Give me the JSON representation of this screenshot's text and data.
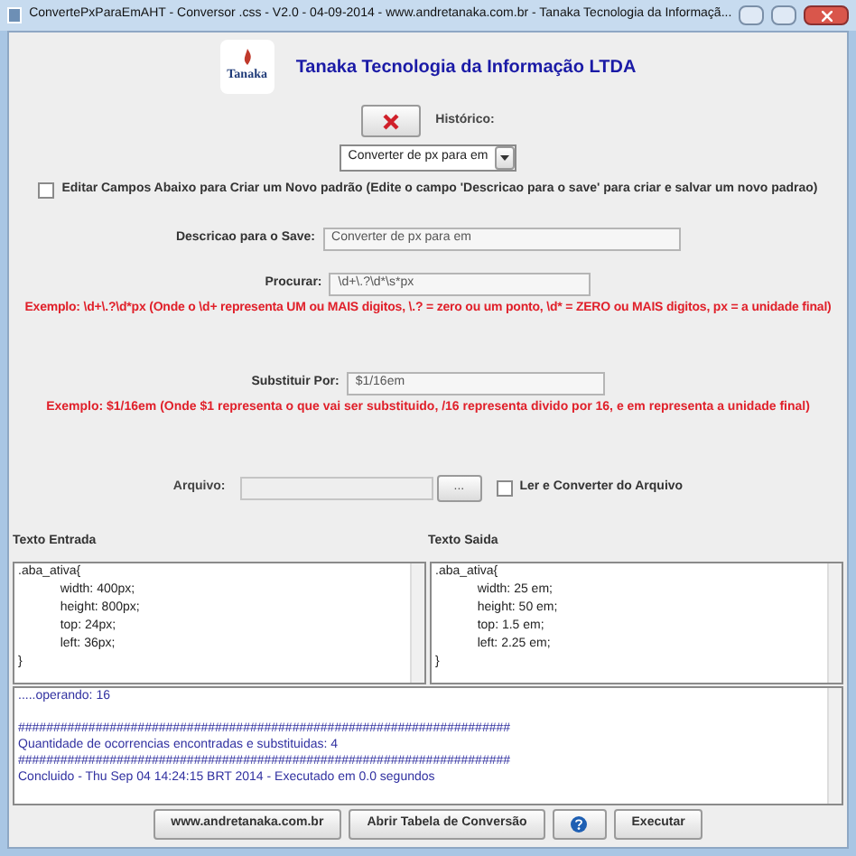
{
  "window": {
    "title": "ConvertePxParaEmAHT - Conversor .css  - V2.0 - 04-09-2014 - www.andretanaka.com.br - Tanaka Tecnologia da Informaçã..."
  },
  "header": {
    "logo_text": "Tanaka",
    "company": "Tanaka Tecnologia da Informação LTDA"
  },
  "historico": {
    "label": "Histórico:",
    "value": "Converter de px para em"
  },
  "edit_checkbox": {
    "label": "Editar Campos Abaixo para Criar um Novo padrão (Edite o campo 'Descricao para o save' para criar e salvar um novo padrao)",
    "checked": false
  },
  "descricao": {
    "label": "Descricao para o Save:",
    "value": "Converter de px para em"
  },
  "procurar": {
    "label": "Procurar:",
    "value": "\\d+\\.?\\d*\\s*px",
    "example": "Exemplo: \\d+\\.?\\d*px (Onde o \\d+ representa UM ou MAIS digitos, \\.? = zero ou um ponto, \\d* = ZERO ou MAIS digitos,  px = a unidade final)"
  },
  "substituir": {
    "label": "Substituir Por:",
    "value": "$1/16em",
    "example": "Exemplo: $1/16em (Onde $1 representa o que vai ser substituido, /16 representa divido por 16, e em representa a unidade final)"
  },
  "arquivo": {
    "label": "Arquivo:",
    "browse": "...",
    "read_checkbox": {
      "label": "Ler e Converter do Arquivo",
      "checked": false
    }
  },
  "texto_entrada": {
    "label": "Texto Entrada",
    "lines": [
      ".aba_ativa{",
      "\t\twidth: 400px;",
      "\t\theight: 800px;",
      "\t\ttop: 24px;",
      "\t\tleft: 36px;",
      "}"
    ]
  },
  "texto_saida": {
    "label": "Texto Saida",
    "lines": [
      ".aba_ativa{",
      "\t\twidth: 25 em;",
      "\t\theight: 50 em;",
      "\t\ttop: 1.5 em;",
      "\t\tleft: 2.25 em;",
      "}"
    ]
  },
  "log": [
    ".....operando: 16",
    "######################################################################",
    "Quantidade de ocorrencias encontradas e substituidas: 4",
    "######################################################################",
    "Concluido - Thu Sep 04 14:24:15 BRT 2014 - Executado em 0.0 segundos"
  ],
  "buttons": [
    {
      "label": "www.andretanaka.com.br",
      "kind": "text"
    },
    {
      "label": "Abrir Tabela de Conversão",
      "kind": "text"
    },
    {
      "kind": "help"
    },
    {
      "label": "Executar",
      "kind": "text"
    }
  ]
}
